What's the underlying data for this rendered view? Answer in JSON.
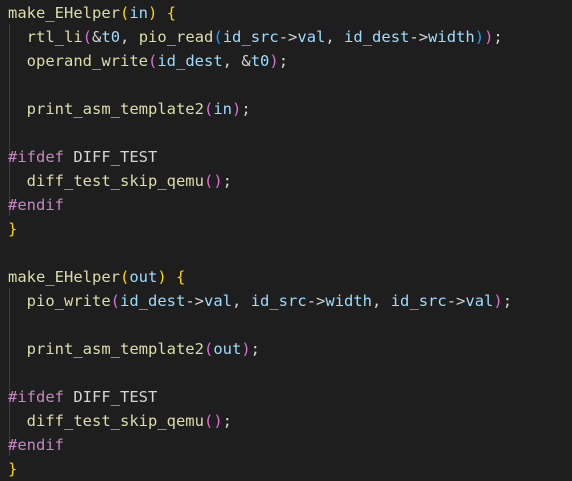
{
  "lines": [
    [
      [
        "fn",
        "make_EHelper"
      ],
      [
        "p1",
        "("
      ],
      [
        "var",
        "in"
      ],
      [
        "p1",
        ")"
      ],
      [
        "plain",
        " "
      ],
      [
        "p1",
        "{"
      ]
    ],
    [
      [
        "plain",
        "  "
      ],
      [
        "fn",
        "rtl_li"
      ],
      [
        "p2",
        "("
      ],
      [
        "plain",
        "&"
      ],
      [
        "var",
        "t0"
      ],
      [
        "plain",
        ", "
      ],
      [
        "fn",
        "pio_read"
      ],
      [
        "p3",
        "("
      ],
      [
        "var",
        "id_src"
      ],
      [
        "plain",
        "->"
      ],
      [
        "var",
        "val"
      ],
      [
        "plain",
        ", "
      ],
      [
        "var",
        "id_dest"
      ],
      [
        "plain",
        "->"
      ],
      [
        "var",
        "width"
      ],
      [
        "p3",
        ")"
      ],
      [
        "p2",
        ")"
      ],
      [
        "plain",
        ";"
      ]
    ],
    [
      [
        "plain",
        "  "
      ],
      [
        "fn",
        "operand_write"
      ],
      [
        "p2",
        "("
      ],
      [
        "var",
        "id_dest"
      ],
      [
        "plain",
        ", "
      ],
      [
        "plain",
        "&"
      ],
      [
        "var",
        "t0"
      ],
      [
        "p2",
        ")"
      ],
      [
        "plain",
        ";"
      ]
    ],
    [],
    [
      [
        "plain",
        "  "
      ],
      [
        "fn",
        "print_asm_template2"
      ],
      [
        "p2",
        "("
      ],
      [
        "var",
        "in"
      ],
      [
        "p2",
        ")"
      ],
      [
        "plain",
        ";"
      ]
    ],
    [],
    [
      [
        "pp",
        "#ifdef"
      ],
      [
        "plain",
        " DIFF_TEST"
      ]
    ],
    [
      [
        "plain",
        "  "
      ],
      [
        "fn",
        "diff_test_skip_qemu"
      ],
      [
        "p2",
        "()"
      ],
      [
        "plain",
        ";"
      ]
    ],
    [
      [
        "pp",
        "#endif"
      ]
    ],
    [
      [
        "p1",
        "}"
      ]
    ],
    [],
    [
      [
        "fn",
        "make_EHelper"
      ],
      [
        "p1",
        "("
      ],
      [
        "var",
        "out"
      ],
      [
        "p1",
        ")"
      ],
      [
        "plain",
        " "
      ],
      [
        "p1",
        "{"
      ]
    ],
    [
      [
        "plain",
        "  "
      ],
      [
        "fn",
        "pio_write"
      ],
      [
        "p2",
        "("
      ],
      [
        "var",
        "id_dest"
      ],
      [
        "plain",
        "->"
      ],
      [
        "var",
        "val"
      ],
      [
        "plain",
        ", "
      ],
      [
        "var",
        "id_src"
      ],
      [
        "plain",
        "->"
      ],
      [
        "var",
        "width"
      ],
      [
        "plain",
        ", "
      ],
      [
        "var",
        "id_src"
      ],
      [
        "plain",
        "->"
      ],
      [
        "var",
        "val"
      ],
      [
        "p2",
        ")"
      ],
      [
        "plain",
        ";"
      ]
    ],
    [],
    [
      [
        "plain",
        "  "
      ],
      [
        "fn",
        "print_asm_template2"
      ],
      [
        "p2",
        "("
      ],
      [
        "var",
        "out"
      ],
      [
        "p2",
        ")"
      ],
      [
        "plain",
        ";"
      ]
    ],
    [],
    [
      [
        "pp",
        "#ifdef"
      ],
      [
        "plain",
        " DIFF_TEST"
      ]
    ],
    [
      [
        "plain",
        "  "
      ],
      [
        "fn",
        "diff_test_skip_qemu"
      ],
      [
        "p2",
        "()"
      ],
      [
        "plain",
        ";"
      ]
    ],
    [
      [
        "pp",
        "#endif"
      ]
    ],
    [
      [
        "p1",
        "}"
      ]
    ]
  ]
}
